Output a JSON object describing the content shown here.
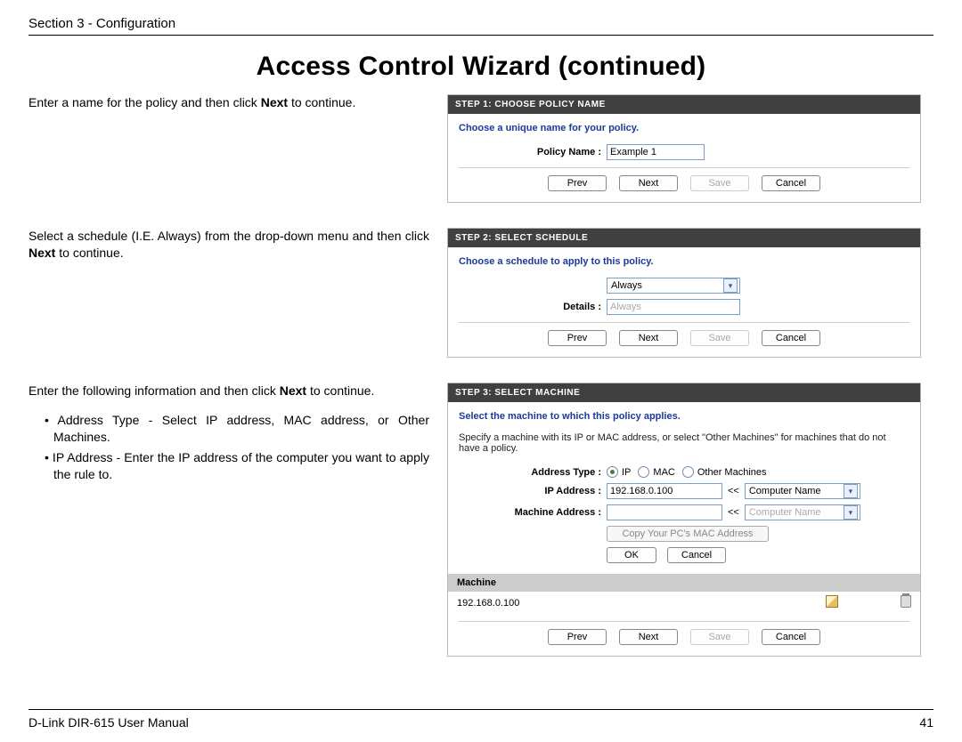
{
  "header": {
    "section": "Section 3 - Configuration"
  },
  "title": "Access Control Wizard (continued)",
  "instructions": {
    "step1_pre": "Enter a name for the policy and then click ",
    "step1_bold": "Next",
    "step1_post": " to continue.",
    "step2_pre": "Select a schedule (I.E. Always) from the drop-down menu and then click ",
    "step2_bold": "Next",
    "step2_post": " to continue.",
    "step3_pre": "Enter the following information and then click ",
    "step3_bold": "Next",
    "step3_post": " to continue.",
    "bullet1": "• Address Type - Select IP address, MAC address, or Other Machines.",
    "bullet2": "• IP Address - Enter the IP address of the computer you want to apply the rule to."
  },
  "panel1": {
    "header": "STEP 1: CHOOSE POLICY NAME",
    "prompt": "Choose a unique name for your policy.",
    "label": "Policy Name :",
    "value": "Example 1"
  },
  "panel2": {
    "header": "STEP 2: SELECT SCHEDULE",
    "prompt": "Choose a schedule to apply to this policy.",
    "detailsLabel": "Details :",
    "selectValue": "Always",
    "detailsValue": "Always"
  },
  "panel3": {
    "header": "STEP 3: SELECT MACHINE",
    "prompt": "Select the machine to which this policy applies.",
    "desc": "Specify a machine with its IP or MAC address, or select \"Other Machines\" for machines that do not have a policy.",
    "addrTypeLabel": "Address Type :",
    "radio_ip": "IP",
    "radio_mac": "MAC",
    "radio_other": "Other Machines",
    "ipLabel": "IP Address :",
    "ipValue": "192.168.0.100",
    "ipSelect": "Computer Name",
    "macLabel": "Machine Address :",
    "macSelect": "Computer Name",
    "copyBtn": "Copy Your PC's MAC Address",
    "okBtn": "OK",
    "cancelSmall": "Cancel",
    "tableHeader": "Machine",
    "tableRowIp": "192.168.0.100",
    "arrow": "<<"
  },
  "buttons": {
    "prev": "Prev",
    "next": "Next",
    "save": "Save",
    "cancel": "Cancel"
  },
  "footer": {
    "left": "D-Link DIR-615 User Manual",
    "right": "41"
  }
}
